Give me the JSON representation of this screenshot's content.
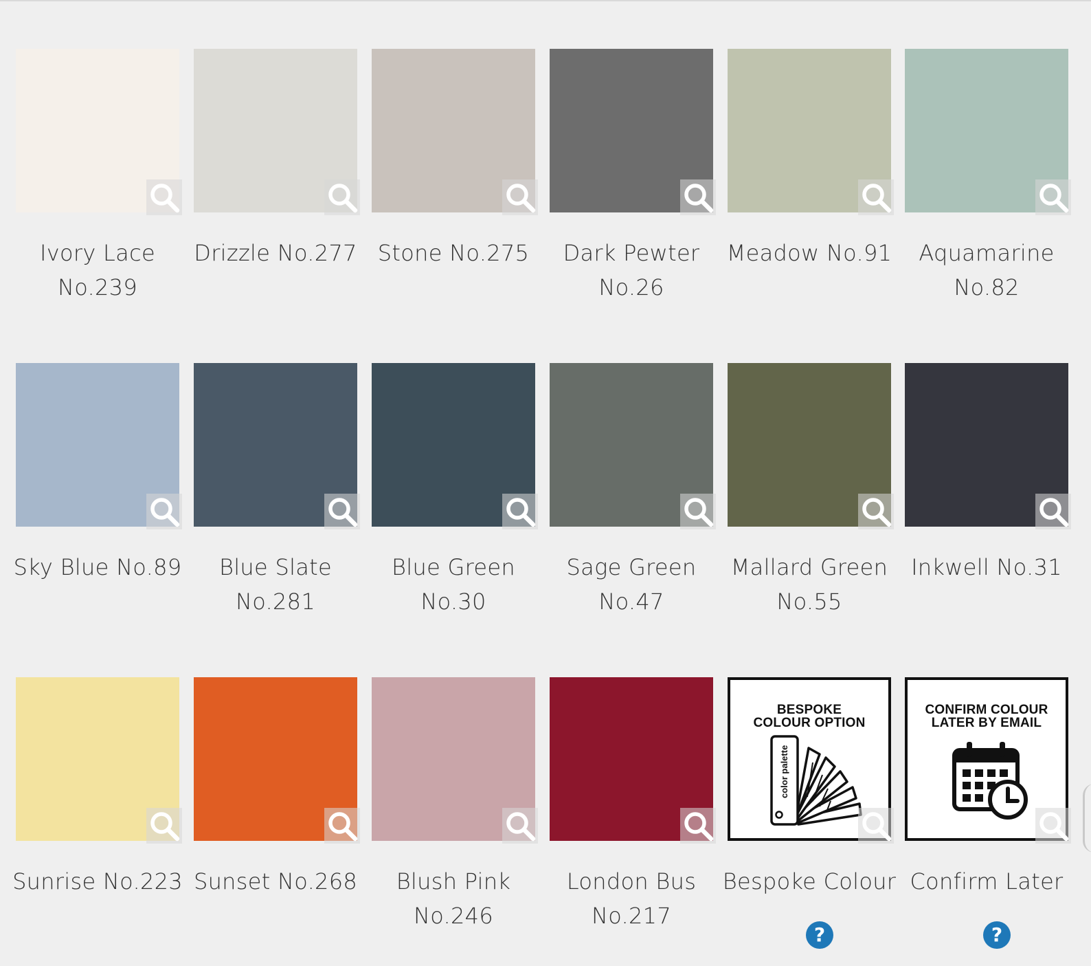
{
  "swatches": [
    {
      "name": "Ivory Lace No.239",
      "color": "#f5f0ea"
    },
    {
      "name": "Drizzle No.277",
      "color": "#dcdbd6"
    },
    {
      "name": "Stone No.275",
      "color": "#c9c2bc"
    },
    {
      "name": "Dark Pewter No.26",
      "color": "#6d6d6d"
    },
    {
      "name": "Meadow No.91",
      "color": "#bfc3ae"
    },
    {
      "name": "Aquamarine No.82",
      "color": "#abc2b9"
    },
    {
      "name": "Sky Blue No.89",
      "color": "#a6b7cb"
    },
    {
      "name": "Blue Slate No.281",
      "color": "#4a5967"
    },
    {
      "name": "Blue Green No.30",
      "color": "#3d4e59"
    },
    {
      "name": "Sage Green No.47",
      "color": "#676d68"
    },
    {
      "name": "Mallard Green No.55",
      "color": "#62654a"
    },
    {
      "name": "Inkwell No.31",
      "color": "#35363e"
    },
    {
      "name": "Sunrise No.223",
      "color": "#f3e39f"
    },
    {
      "name": "Sunset No.268",
      "color": "#e05d23"
    },
    {
      "name": "Blush Pink No.246",
      "color": "#c9a5a9"
    },
    {
      "name": "London Bus No.217",
      "color": "#8c162c"
    }
  ],
  "special_options": [
    {
      "name": "Bespoke Colour",
      "panel_line1": "BESPOKE",
      "panel_line2": "COLOUR OPTION",
      "palette_text": "color palette",
      "icon": "color-fan-icon",
      "help": "?"
    },
    {
      "name": "Confirm Later",
      "panel_line1": "CONFIRM COLOUR",
      "panel_line2": "LATER BY EMAIL",
      "icon": "calendar-clock-icon",
      "help": "?"
    }
  ]
}
